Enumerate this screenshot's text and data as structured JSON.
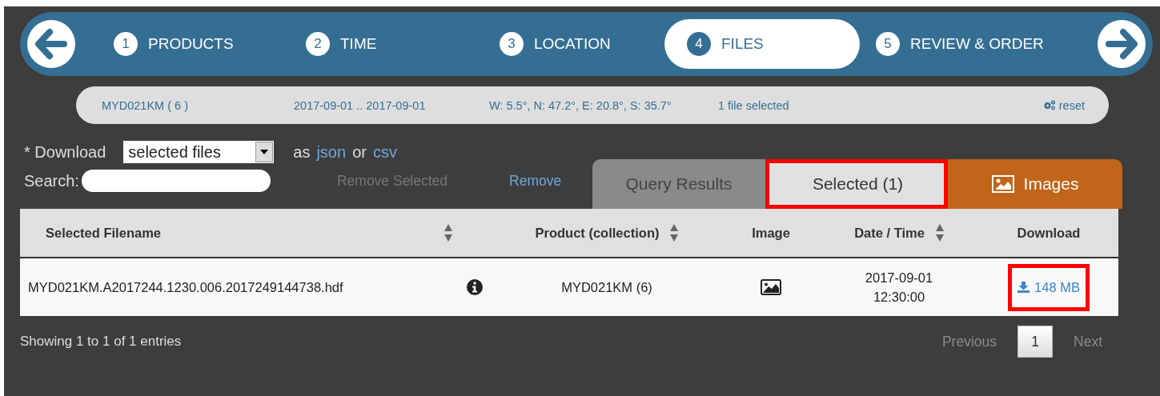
{
  "steps": [
    {
      "number": "1",
      "label": "PRODUCTS",
      "selected": false
    },
    {
      "number": "2",
      "label": "TIME",
      "selected": false
    },
    {
      "number": "3",
      "label": "LOCATION",
      "selected": false
    },
    {
      "number": "4",
      "label": "FILES",
      "selected": true
    },
    {
      "number": "5",
      "label": "REVIEW & ORDER",
      "selected": false
    }
  ],
  "summary": {
    "product": "MYD021KM ( 6 )",
    "dates": "2017-09-01 .. 2017-09-01",
    "bounds": "W: 5.5°, N: 47.2°, E: 20.8°, S: 35.7°",
    "selection": "1 file selected",
    "reset": "reset"
  },
  "download": {
    "label": "* Download",
    "select_value": "selected files",
    "as": "as",
    "json_link": "json",
    "or": "or",
    "csv_link": "csv"
  },
  "search": {
    "label": "Search:"
  },
  "remove_selected": {
    "label": "Remove Selected",
    "disabled": true
  },
  "remove_all": {
    "label": "Remove",
    "disabled": false
  },
  "tabs": [
    {
      "kind": "plain",
      "label": "Query Results",
      "selected": false,
      "highlighted": false
    },
    {
      "kind": "plain",
      "label": "Selected (1)",
      "selected": true,
      "highlighted": true
    },
    {
      "kind": "images",
      "label": "Images",
      "selected": false,
      "highlighted": false
    }
  ],
  "table": {
    "columns": [
      {
        "label": "Selected Filename",
        "sortable": true
      },
      {
        "sortable": false
      },
      {
        "label": "Product (collection)",
        "sortable": true
      },
      {
        "label": "Image",
        "sortable": false
      },
      {
        "label": "Date / Time",
        "sortable": true
      },
      {
        "label": "Download",
        "sortable": false
      }
    ],
    "rows": [
      {
        "filename": "MYD021KM.A2017244.1230.006.2017249144738.hdf",
        "product": "MYD021KM (6)",
        "date": "2017-09-01",
        "time": "12:30:00",
        "download": "148 MB",
        "download_highlighted": true
      }
    ]
  },
  "footer": {
    "info": "Showing 1 to 1 of 1 entries",
    "previous": "Previous",
    "pages": [
      {
        "label": "1",
        "selected": true
      }
    ],
    "next": "Next"
  }
}
